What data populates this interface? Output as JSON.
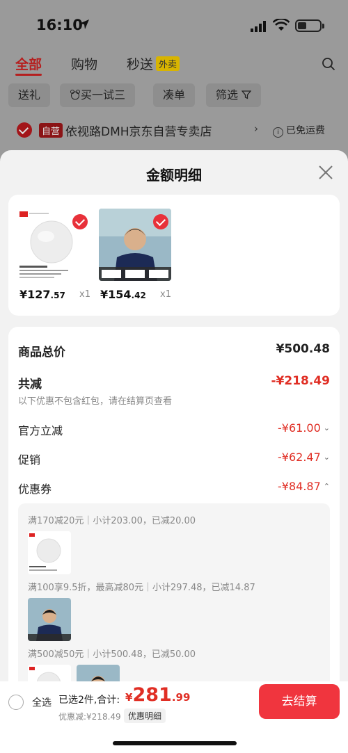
{
  "status_bar": {
    "time": "16:10"
  },
  "tabs": [
    {
      "label": "全部"
    },
    {
      "label": "购物"
    },
    {
      "label": "秒送",
      "badge": "外卖"
    }
  ],
  "filters": [
    "送礼",
    "买一试三",
    "凑单",
    "筛选"
  ],
  "shop": {
    "badge": "自营",
    "name": "依视路DMH京东自营专卖店",
    "arrow": "›",
    "shipping": "已免运费",
    "info_glyph": "i"
  },
  "sheet": {
    "title": "金额明细"
  },
  "products": [
    {
      "price_int": "¥127",
      "price_dec": ".57",
      "qty": "x1"
    },
    {
      "price_int": "¥154",
      "price_dec": ".42",
      "qty": "x1"
    }
  ],
  "details": {
    "total_label": "商品总价",
    "total_value": "¥500.48",
    "reduce_label": "共减",
    "reduce_value": "-¥218.49",
    "note": "以下优惠不包含红包，请在结算页查看",
    "rows": [
      {
        "label": "官方立减",
        "value": "-¥61.00",
        "chevron": "⌄"
      },
      {
        "label": "促销",
        "value": "-¥62.47",
        "chevron": "⌄"
      },
      {
        "label": "优惠券",
        "value": "-¥84.87",
        "chevron": "⌃"
      }
    ]
  },
  "coupons": [
    {
      "text": "满170减20元｜小计203.00，已减20.00"
    },
    {
      "text": "满100享9.5折，最高减80元｜小计297.48，已减14.87"
    },
    {
      "text": "满500减50元｜小计500.48，已减50.00"
    }
  ],
  "bottom": {
    "select_all": "全选",
    "selected_text": "已选2件,合计:",
    "total_symbol": "¥",
    "total_int": "281",
    "total_dec": ".99",
    "discount": "优惠减:¥218.49",
    "detail_btn": "优惠明细",
    "checkout": "去结算"
  },
  "colors": {
    "accent": "#e02e24",
    "checkout": "#f0353e"
  }
}
